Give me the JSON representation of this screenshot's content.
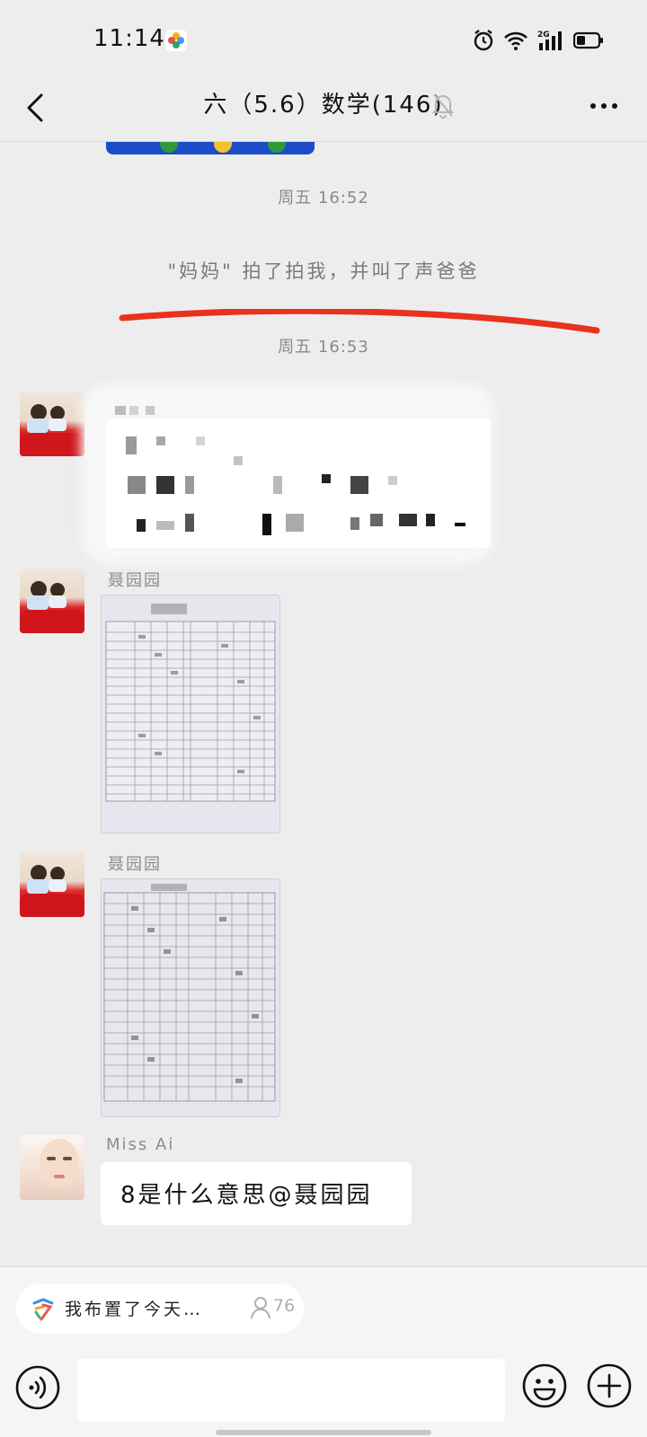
{
  "status_bar": {
    "time": "11:14",
    "network": "2G"
  },
  "header": {
    "title": "六（5.6）数学(146)",
    "back_icon": "back-arrow-icon",
    "mute_icon": "bell-muted-icon",
    "more_icon": "more-dots-icon"
  },
  "chat": {
    "timestamps": [
      "周五 16:52",
      "周五 16:53"
    ],
    "system_message": "\"妈妈\" 拍了拍我，并叫了声爸爸",
    "messages": [
      {
        "sender": "",
        "type": "text-redacted"
      },
      {
        "sender": "聂园园",
        "type": "image",
        "description": "photo-of-worksheet"
      },
      {
        "sender": "聂园园",
        "type": "image",
        "description": "photo-of-worksheet"
      },
      {
        "sender": "Miss   Ai",
        "type": "text",
        "text": "8是什么意思@聂园园"
      }
    ]
  },
  "bottom": {
    "task_text": "我布置了今天…",
    "task_count": "76",
    "input_value": "",
    "voice_icon": "voice-icon",
    "emoji_icon": "emoji-icon",
    "plus_icon": "plus-icon"
  },
  "colors": {
    "background": "#ededed",
    "red_stroke": "#e8321e",
    "bubble": "#ffffff"
  }
}
